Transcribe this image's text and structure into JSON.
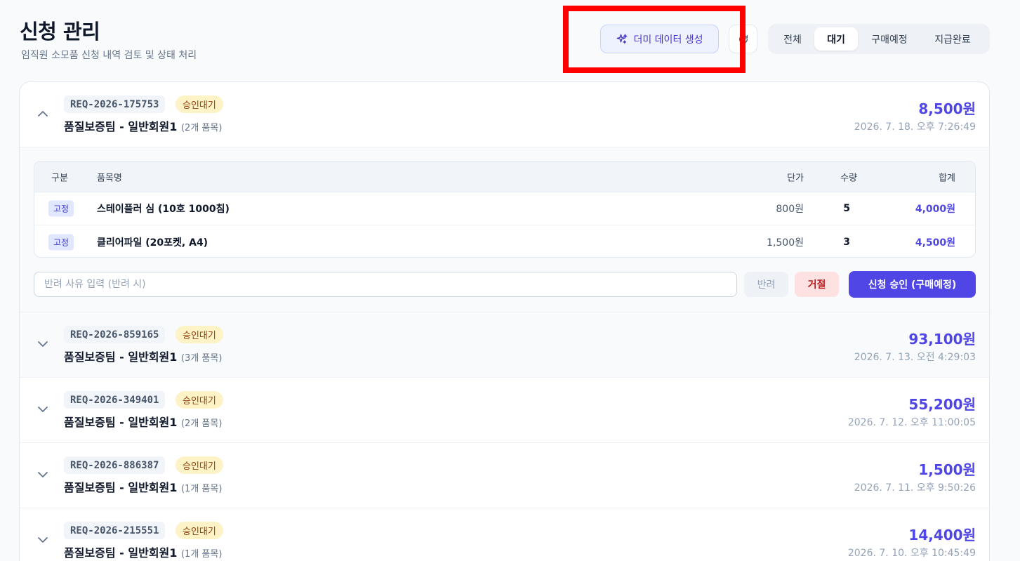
{
  "header": {
    "title": "신청 관리",
    "subtitle": "임직원 소모품 신청 내역 검토 및 상태 처리",
    "dummy_button": "더미 데이터 생성",
    "reset_icon": "refresh-icon"
  },
  "tabs": [
    {
      "label": "전체",
      "active": false
    },
    {
      "label": "대기",
      "active": true
    },
    {
      "label": "구매예정",
      "active": false
    },
    {
      "label": "지급완료",
      "active": false
    }
  ],
  "requests": [
    {
      "id": "REQ-2026-175753",
      "status": "승인대기",
      "who": "품질보증팀 - 일반회원1",
      "count": "(2개 품목)",
      "amount": "8,500원",
      "date": "2026. 7. 18. 오후 7:26:49",
      "expanded": true
    },
    {
      "id": "REQ-2026-859165",
      "status": "승인대기",
      "who": "품질보증팀 - 일반회원1",
      "count": "(3개 품목)",
      "amount": "93,100원",
      "date": "2026. 7. 13. 오전 4:29:03",
      "expanded": false
    },
    {
      "id": "REQ-2026-349401",
      "status": "승인대기",
      "who": "품질보증팀 - 일반회원1",
      "count": "(2개 품목)",
      "amount": "55,200원",
      "date": "2026. 7. 12. 오후 11:00:05",
      "expanded": false
    },
    {
      "id": "REQ-2026-886387",
      "status": "승인대기",
      "who": "품질보증팀 - 일반회원1",
      "count": "(1개 품목)",
      "amount": "1,500원",
      "date": "2026. 7. 11. 오후 9:50:26",
      "expanded": false
    },
    {
      "id": "REQ-2026-215551",
      "status": "승인대기",
      "who": "품질보증팀 - 일반회원1",
      "count": "(1개 품목)",
      "amount": "14,400원",
      "date": "2026. 7. 10. 오후 10:45:49",
      "expanded": false
    }
  ],
  "detail": {
    "columns": {
      "category": "구분",
      "name": "품목명",
      "price": "단가",
      "qty": "수량",
      "total": "합계"
    },
    "items": [
      {
        "category": "고정",
        "name": "스테이플러 심 (10호 1000침)",
        "price": "800원",
        "qty": "5",
        "total": "4,000원"
      },
      {
        "category": "고정",
        "name": "클리어파일 (20포켓, A4)",
        "price": "1,500원",
        "qty": "3",
        "total": "4,500원"
      }
    ],
    "reason_placeholder": "반려 사유 입력 (반려 시)",
    "return_label": "반려",
    "reject_label": "거절",
    "approve_label": "신청 승인 (구매예정)"
  },
  "colors": {
    "accent": "#4f46e5",
    "badge_bg": "#fef3c7",
    "badge_text": "#92400e",
    "reject_bg": "#fee2e2",
    "highlight": "#ff0000"
  }
}
